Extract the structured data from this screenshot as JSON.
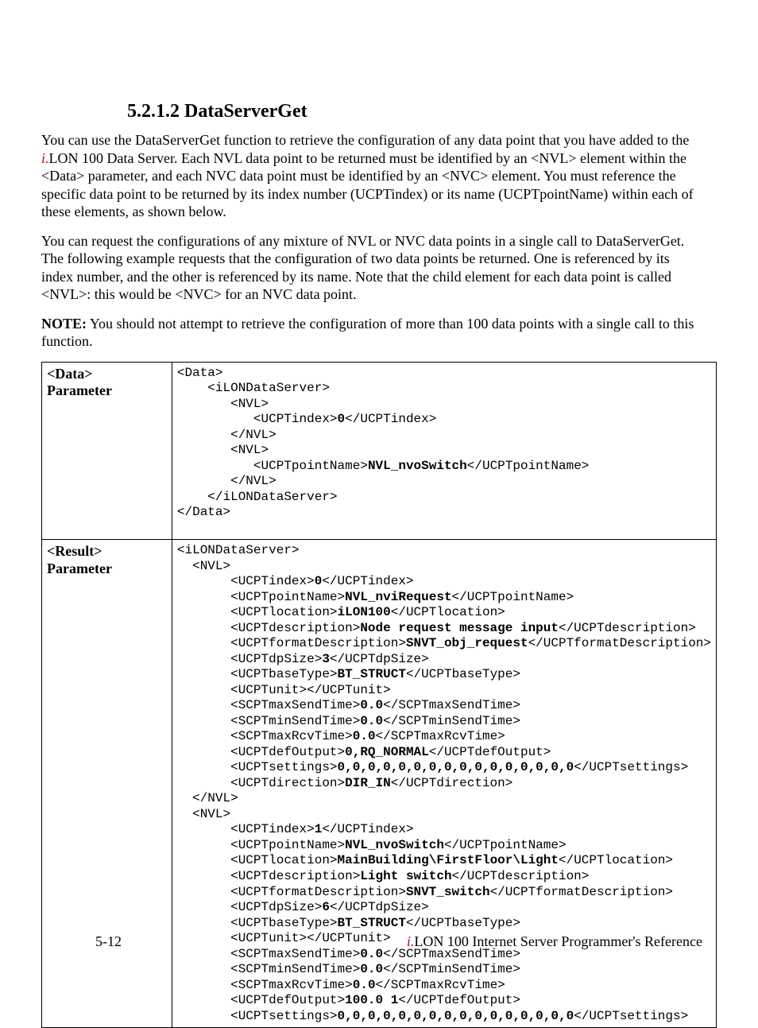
{
  "heading": {
    "number": "5.2.1.2",
    "title": "DataServerGet"
  },
  "para1_a": "You can use the DataServerGet function to retrieve the configuration of any data point that you have added to the ",
  "para1_i": "i.",
  "para1_b": "LON 100 Data Server. Each NVL data point to be returned must be identified by an <NVL> element within the <Data> parameter, and each NVC data point must be identified by an <NVC> element. You must reference the specific data point to be returned by its index number (UCPTindex) or its name (UCPTpointName) within each of these elements, as shown below.",
  "para2": "You can request the configurations of any mixture of NVL or NVC data points in a single call to DataServerGet. The following example requests that the configuration of two data points be returned. One is referenced by its index number, and the other is referenced by its name. Note that the child element for each data point is called <NVL>: this would be <NVC> for an NVC data point.",
  "note_label": "NOTE:",
  "note_text": " You should not attempt to retrieve the configuration of more than 100 data points with a single call to this function.",
  "table": {
    "row1": {
      "label1": "<Data>",
      "label2": "Parameter"
    },
    "row2": {
      "label1": "<Result>",
      "label2": "Parameter"
    }
  },
  "footer": {
    "page": "5-12",
    "book_i": "i.",
    "book_rest": "LON 100 Internet Server Programmer's Reference"
  },
  "code1": {
    "l01": "<Data>",
    "l02": "    <iLONDataServer>",
    "l03": "       <NVL>",
    "l04": "          <UCPTindex>",
    "l04b": "0",
    "l04c": "</UCPTindex>",
    "l05": "       </NVL>",
    "l06": "       <NVL>",
    "l07": "          <UCPTpointName>",
    "l07b": "NVL_nvoSwitch",
    "l07c": "</UCPTpointName>",
    "l08": "       </NVL>",
    "l09": "    </iLONDataServer>",
    "l10": "</Data>"
  },
  "code2": {
    "l01": "<iLONDataServer>",
    "l02": "  <NVL>",
    "l03": "       <UCPTindex>",
    "l03b": "0",
    "l03c": "</UCPTindex>",
    "l04": "       <UCPTpointName>",
    "l04b": "NVL_nviRequest",
    "l04c": "</UCPTpointName>",
    "l05": "       <UCPTlocation>",
    "l05b": "iLON100",
    "l05c": "</UCPTlocation>",
    "l06": "       <UCPTdescription>",
    "l06b": "Node request message input",
    "l06c": "</UCPTdescription>",
    "l07": "       <UCPTformatDescription>",
    "l07b": "SNVT_obj_request",
    "l07c": "</UCPTformatDescription>",
    "l08": "       <UCPTdpSize>",
    "l08b": "3",
    "l08c": "</UCPTdpSize>",
    "l09": "       <UCPTbaseType>",
    "l09b": "BT_STRUCT",
    "l09c": "</UCPTbaseType>",
    "l10": "       <UCPTunit></UCPTunit>",
    "l11": "       <SCPTmaxSendTime>",
    "l11b": "0.0",
    "l11c": "</SCPTmaxSendTime>",
    "l12": "       <SCPTminSendTime>",
    "l12b": "0.0",
    "l12c": "</SCPTminSendTime>",
    "l13": "       <SCPTmaxRcvTime>",
    "l13b": "0.0",
    "l13c": "</SCPTmaxRcvTime>",
    "l14": "       <UCPTdefOutput>",
    "l14b": "0,RQ_NORMAL",
    "l14c": "</UCPTdefOutput>",
    "l15": "       <UCPTsettings>",
    "l15b": "0,0,0,0,0,0,0,0,0,0,0,0,0,0,0,0",
    "l15c": "</UCPTsettings>",
    "l16": "       <UCPTdirection>",
    "l16b": "DIR_IN",
    "l16c": "</UCPTdirection>",
    "l17": "  </NVL>",
    "l18": "  <NVL>",
    "l19": "       <UCPTindex>",
    "l19b": "1",
    "l19c": "</UCPTindex>",
    "l20": "       <UCPTpointName>",
    "l20b": "NVL_nvoSwitch",
    "l20c": "</UCPTpointName>",
    "l21": "       <UCPTlocation>",
    "l21b": "MainBuilding\\FirstFloor\\Light",
    "l21c": "</UCPTlocation>",
    "l22": "       <UCPTdescription>",
    "l22b": "Light switch",
    "l22c": "</UCPTdescription>",
    "l23": "       <UCPTformatDescription>",
    "l23b": "SNVT_switch",
    "l23c": "</UCPTformatDescription>",
    "l24": "       <UCPTdpSize>",
    "l24b": "6",
    "l24c": "</UCPTdpSize>",
    "l25": "       <UCPTbaseType>",
    "l25b": "BT_STRUCT",
    "l25c": "</UCPTbaseType>",
    "l26": "       <UCPTunit></UCPTunit>",
    "l27": "       <SCPTmaxSendTime>",
    "l27b": "0.0",
    "l27c": "</SCPTmaxSendTime>",
    "l28": "       <SCPTminSendTime>",
    "l28b": "0.0",
    "l28c": "</SCPTminSendTime>",
    "l29": "       <SCPTmaxRcvTime>",
    "l29b": "0.0",
    "l29c": "</SCPTmaxRcvTime>",
    "l30": "       <UCPTdefOutput>",
    "l30b": "100.0 1",
    "l30c": "</UCPTdefOutput>",
    "l31": "       <UCPTsettings>",
    "l31b": "0,0,0,0,0,0,0,0,0,0,0,0,0,0,0,0",
    "l31c": "</UCPTsettings>"
  }
}
